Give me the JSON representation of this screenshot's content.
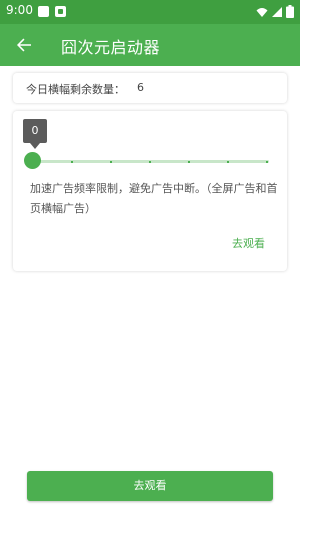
{
  "status_bar": {
    "time": "9:00",
    "icons": [
      "notification-icon",
      "notification-icon",
      "wifi-icon",
      "signal-icon",
      "battery-icon"
    ]
  },
  "app_bar": {
    "title": "囧次元启动器",
    "back_icon": "arrow-back-icon"
  },
  "banner_count": {
    "label": "今日横幅剩余数量：",
    "value": "6"
  },
  "slider": {
    "tooltip": "0",
    "value": 0,
    "max": 6,
    "accent": "#4caf50"
  },
  "description": "加速广告频率限制，避免广告中断。（全屏广告和首页横幅广告）",
  "card_action": "去观看",
  "bottom_button": "去观看",
  "colors": {
    "status_bar": "#3f9f40",
    "app_bar": "#4caf50",
    "accent": "#4caf50"
  }
}
